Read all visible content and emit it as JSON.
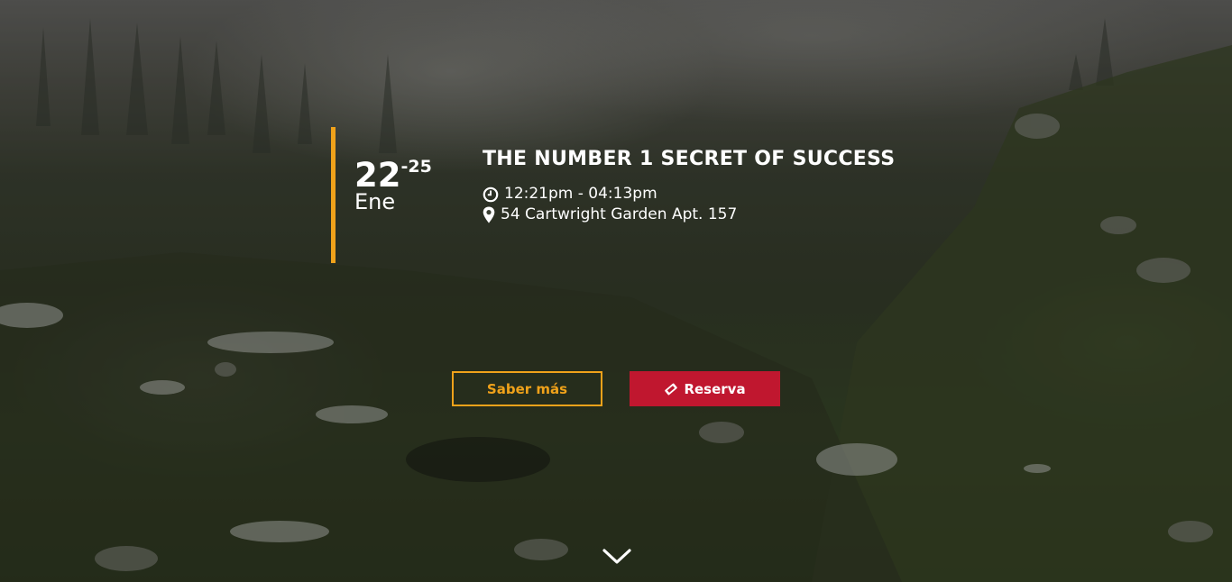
{
  "event": {
    "date": {
      "day": "22",
      "end": "-25",
      "month": "Ene"
    },
    "title": "THE NUMBER 1 SECRET OF SUCCESS",
    "time": "12:21pm - 04:13pm",
    "location": "54 Cartwright Garden Apt. 157"
  },
  "actions": {
    "more_label": "Saber más",
    "reserve_label": "Reserva"
  },
  "icons": {
    "time": "clock-icon",
    "location": "map-marker-icon",
    "reserve": "ticket-icon",
    "scroll": "chevron-down-icon"
  },
  "colors": {
    "accent": "#f0a21a",
    "reserve": "#c0172f",
    "text": "#ffffff"
  }
}
